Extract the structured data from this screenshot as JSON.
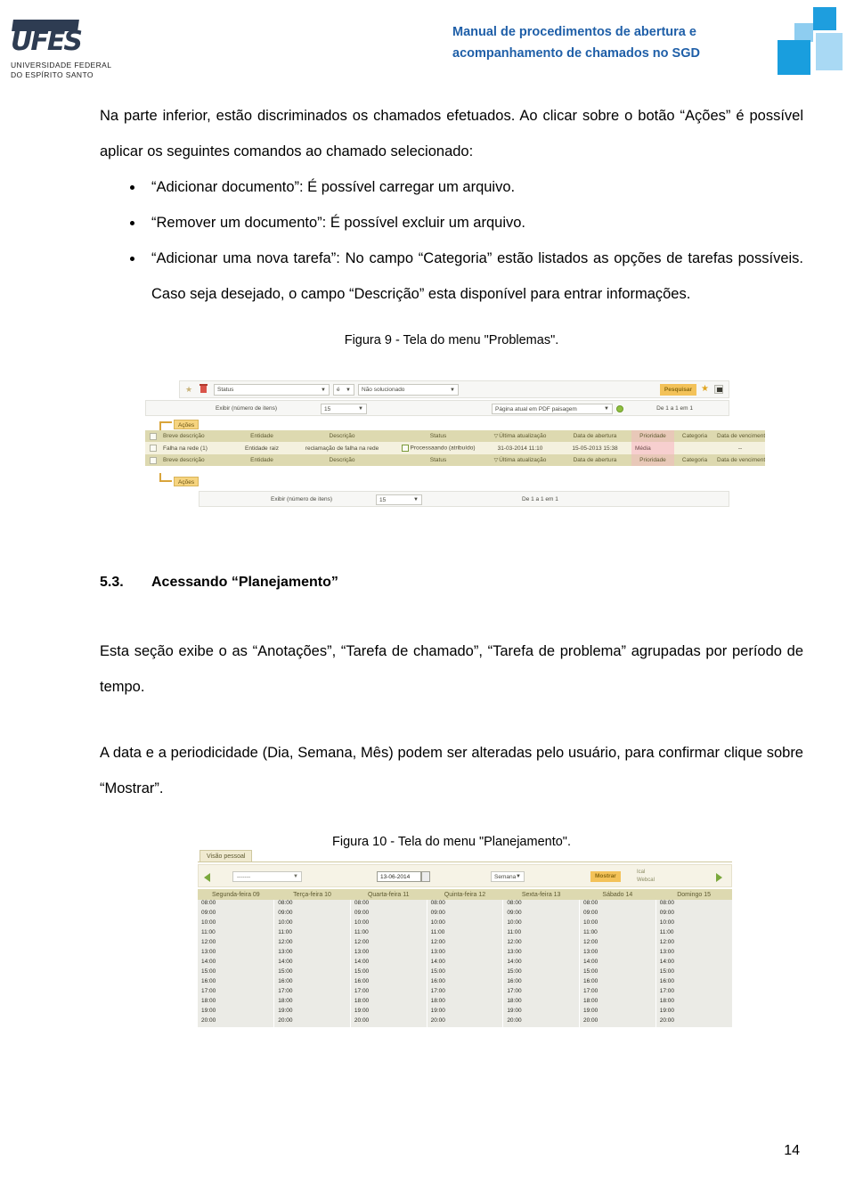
{
  "header": {
    "logo_name_line1": "UNIVERSIDADE FEDERAL",
    "logo_name_line2": "DO ESPÍRITO SANTO",
    "logo_letters": "UFES",
    "title_line1": "Manual de procedimentos de abertura e",
    "title_line2": "acompanhamento de chamados no SGD",
    "title_color": "#1f5fa8"
  },
  "content": {
    "paragraph_1": "Na parte inferior, estão discriminados os chamados efetuados. Ao clicar sobre o botão “Ações” é possível aplicar os seguintes comandos ao chamado selecionado:",
    "bullets": [
      "“Adicionar documento”: É possível carregar um arquivo.",
      "“Remover um documento”: É possível excluir um arquivo.",
      "“Adicionar uma nova tarefa”: No campo “Categoria” estão listados as opções de tarefas possíveis. Caso seja desejado, o campo “Descrição” esta disponível para entrar informações."
    ],
    "figure9_caption": "Figura 9 - Tela do menu \"Problemas\".",
    "section_number": "5.3.",
    "section_title": "Acessando “Planejamento”",
    "paragraph_2": "Esta seção exibe o as “Anotações”, “Tarefa de chamado”, “Tarefa de problema” agrupadas por período de tempo.",
    "paragraph_3": "A data e a periodicidade (Dia, Semana, Mês) podem ser alteradas pelo usuário, para confirmar clique sobre “Mostrar”.",
    "figure10_caption": "Figura 10 - Tela do menu \"Planejamento\"."
  },
  "figure9": {
    "search": {
      "field_label": "Status",
      "operator": "é",
      "value": "Não solucionado",
      "search_button": "Pesquisar"
    },
    "pagebar": {
      "items_label": "Exibir (número de itens)",
      "items_value": "15",
      "export_value": "Página atual em PDF paisagem",
      "range_text": "De 1 a 1 em 1"
    },
    "actions_button": "Ações",
    "table": {
      "headers": [
        "Breve descrição",
        "Entidade",
        "Descrição",
        "Status",
        "Última atualização",
        "Data de abertura",
        "Prioridade",
        "Categoria",
        "Data de vencimento"
      ],
      "rows": [
        {
          "breve_descricao": "Falha na rede (1)",
          "entidade": "Entidade raiz",
          "descricao": "reclamação de falha na rede",
          "status": "Processaando (atribuído)",
          "ultima_atualizacao": "31-03-2014 11:10",
          "data_abertura": "15-05-2013 15:38",
          "prioridade": "Média",
          "categoria": "",
          "data_vencimento": "--"
        }
      ]
    },
    "footbar": {
      "items_label": "Exibir (número de itens)",
      "items_value": "15",
      "range_text": "De 1 a 1 em 1"
    }
  },
  "figure10": {
    "tab_label": "Visão pessoal",
    "user_select": "-------",
    "date_value": "13-06-2014",
    "period_value": "Semana",
    "show_button": "Mostrar",
    "ical_label": "Ical",
    "webcal_label": "Webcal",
    "day_headers": [
      "Segunda-feira 09",
      "Terça-feira 10",
      "Quarta-feira 11",
      "Quinta-feira 12",
      "Sexta-feira 13",
      "Sábado 14",
      "Domingo 15"
    ],
    "time_slots": [
      "08:00",
      "09:00",
      "10:00",
      "11:00",
      "12:00",
      "13:00",
      "14:00",
      "15:00",
      "16:00",
      "17:00",
      "18:00",
      "19:00",
      "20:00"
    ]
  },
  "footer": {
    "page_number": "14"
  }
}
